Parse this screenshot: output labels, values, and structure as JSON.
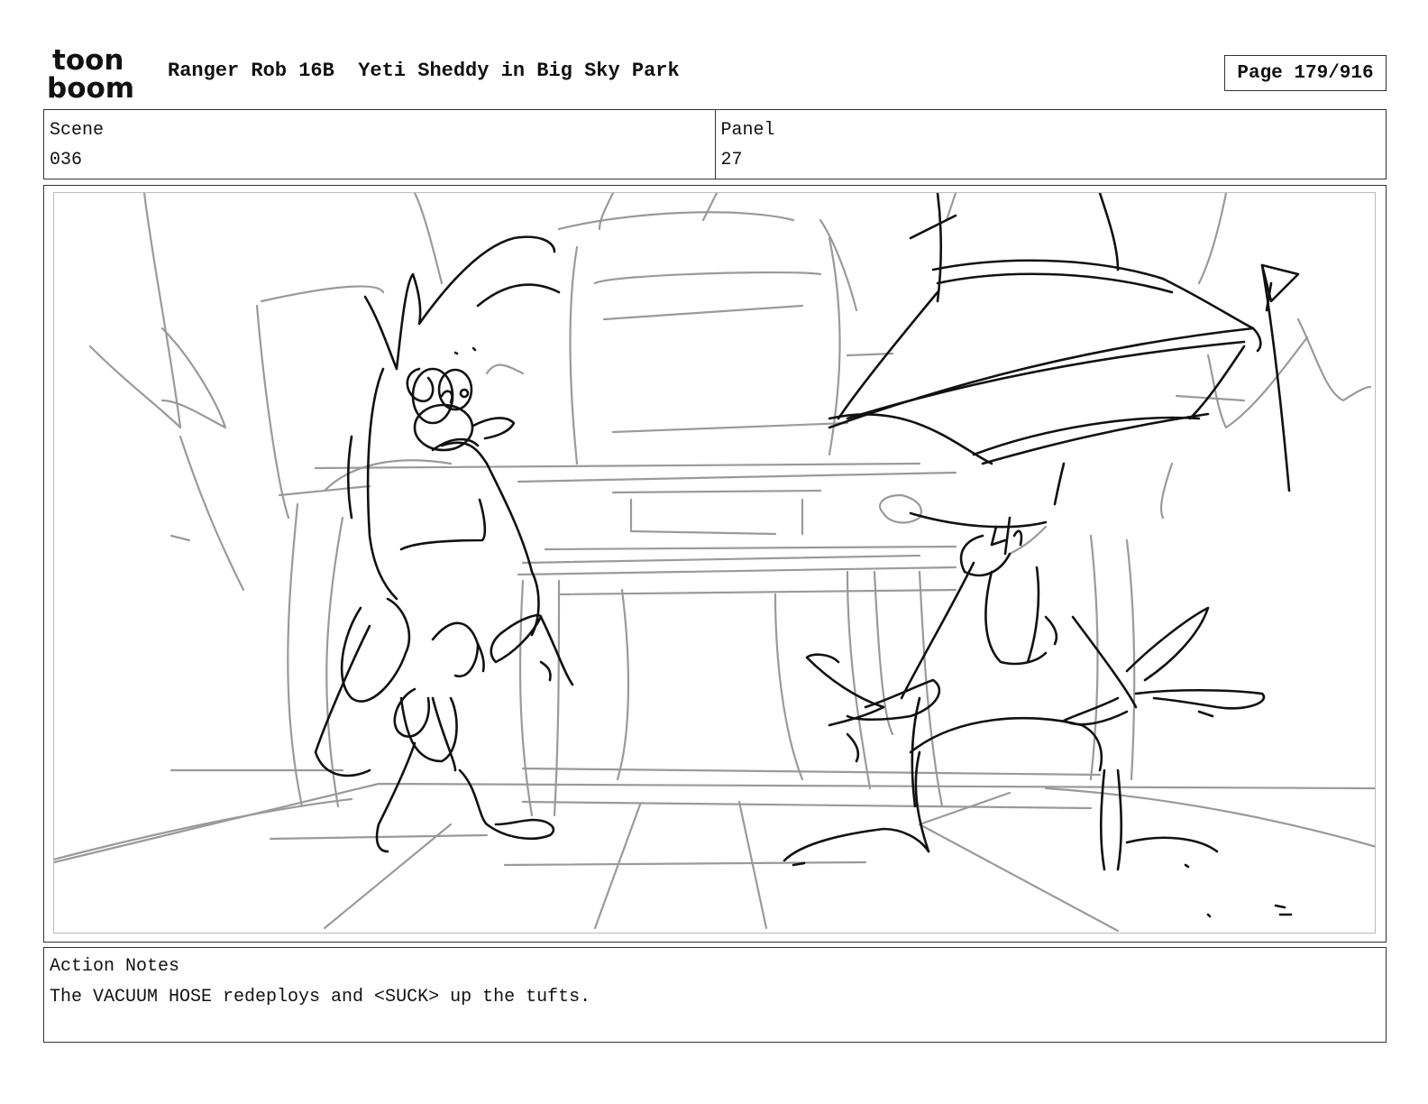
{
  "header": {
    "logo": {
      "top_text": "toon",
      "bottom_text": "boom"
    },
    "title": "Ranger Rob 16B  Yeti Sheddy in Big Sky Park",
    "page": "Page 179/916"
  },
  "scene": {
    "label": "Scene",
    "value": "036"
  },
  "panel": {
    "label": "Panel",
    "value": "27"
  },
  "notes": {
    "label": "Action Notes",
    "text": "The VACUUM HOSE redeploys and <SUCK> up the tufts."
  },
  "colors": {
    "ink": "#111111",
    "sketch_gray": "#9a9a9a",
    "border": "#333333"
  }
}
